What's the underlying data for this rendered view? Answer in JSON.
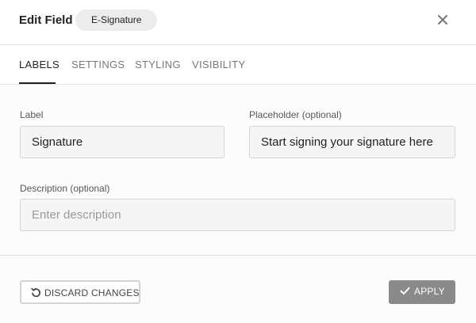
{
  "header": {
    "title": "Edit Field",
    "badge": "E-Signature",
    "close_icon": "close-icon"
  },
  "tabs": [
    {
      "label": "LABELS",
      "active": true
    },
    {
      "label": "SETTINGS",
      "active": false
    },
    {
      "label": "STYLING",
      "active": false
    },
    {
      "label": "VISIBILITY",
      "active": false
    }
  ],
  "form": {
    "label_field": {
      "label": "Label",
      "value": "Signature"
    },
    "placeholder_field": {
      "label": "Placeholder (optional)",
      "value": "Start signing your signature here"
    },
    "description_field": {
      "label": "Description (optional)",
      "value": "",
      "placeholder": "Enter description"
    }
  },
  "footer": {
    "discard_label": "DISCARD CHANGES",
    "discard_icon": "undo-icon",
    "apply_label": "APPLY",
    "apply_icon": "check-icon"
  },
  "colors": {
    "apply_button_bg": "#8a8a8a",
    "active_tab": "#222222",
    "inactive_tab": "#777777"
  }
}
